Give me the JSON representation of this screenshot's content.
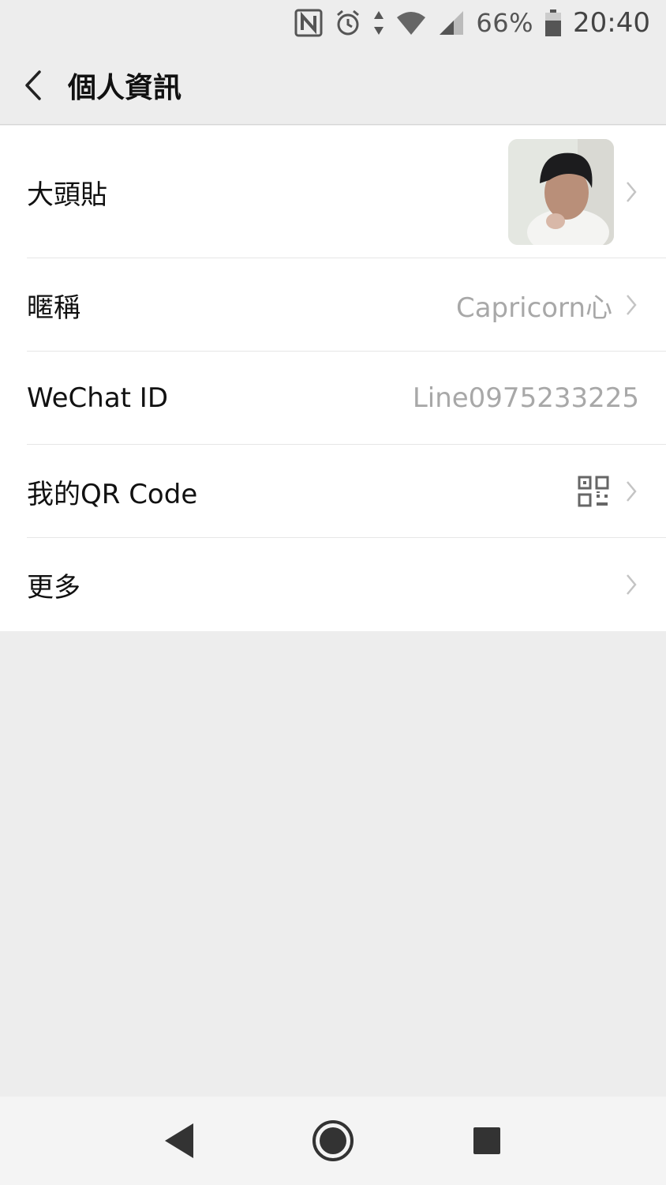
{
  "status_bar": {
    "battery_pct": "66%",
    "time": "20:40",
    "icons": [
      "nfc-icon",
      "alarm-icon",
      "data-arrows-icon",
      "wifi-icon",
      "signal-icon",
      "battery-icon"
    ]
  },
  "header": {
    "title": "個人資訊",
    "back_icon": "chevron-left-icon"
  },
  "rows": [
    {
      "label": "大頭貼",
      "value": "",
      "type": "avatar"
    },
    {
      "label": "暱稱",
      "value": "Capricorn心"
    },
    {
      "label": "WeChat ID",
      "value": "Line0975233225"
    },
    {
      "label": "我的QR Code",
      "value": "",
      "type": "qr"
    },
    {
      "label": "更多",
      "value": ""
    }
  ],
  "colors": {
    "background": "#ededed",
    "row_background": "#ffffff",
    "secondary_text": "#a8a8a8",
    "divider": "#e6e6e6"
  },
  "nav_bar": {
    "icons": [
      "nav-back-icon",
      "nav-home-icon",
      "nav-recents-icon"
    ]
  }
}
